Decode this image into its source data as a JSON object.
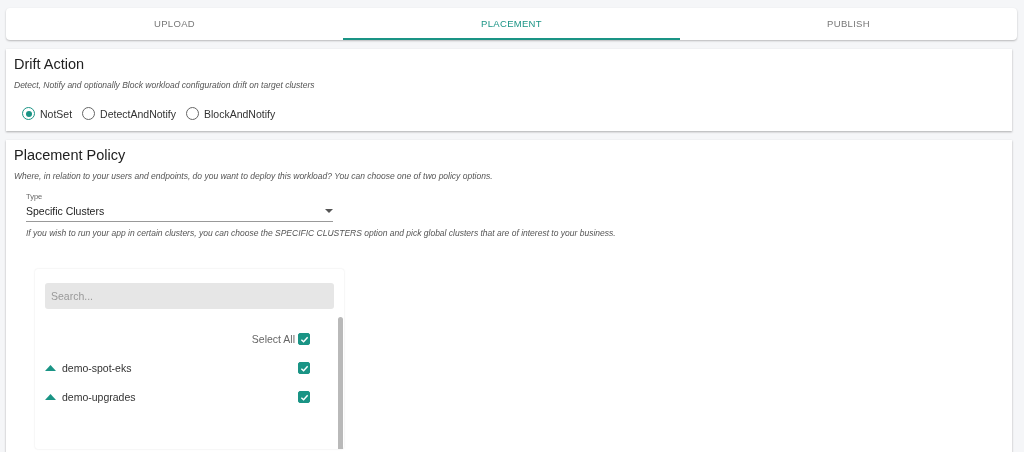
{
  "tabs": [
    {
      "label": "UPLOAD",
      "selected": false
    },
    {
      "label": "PLACEMENT",
      "selected": true
    },
    {
      "label": "PUBLISH",
      "selected": false
    }
  ],
  "drift_action": {
    "title": "Drift Action",
    "description": "Detect, Notify and optionally Block workload configuration drift on target clusters",
    "options": [
      {
        "label": "NotSet",
        "selected": true
      },
      {
        "label": "DetectAndNotify",
        "selected": false
      },
      {
        "label": "BlockAndNotify",
        "selected": false
      }
    ]
  },
  "placement_policy": {
    "title": "Placement Policy",
    "description": "Where, in relation to your users and endpoints, do you want to deploy this workload? You can choose one of two policy options.",
    "type_field": {
      "label": "Type",
      "value": "Specific Clusters"
    },
    "hint": "If you wish to run your app in certain clusters, you can choose the SPECIFIC CLUSTERS option and pick global clusters that are of interest to your business.",
    "cluster_list": {
      "search": {
        "placeholder": "Search..."
      },
      "select_all": {
        "label": "Select All",
        "checked": true
      },
      "clusters": [
        {
          "name": "demo-spot-eks",
          "checked": true
        },
        {
          "name": "demo-upgrades",
          "checked": true
        }
      ]
    }
  }
}
